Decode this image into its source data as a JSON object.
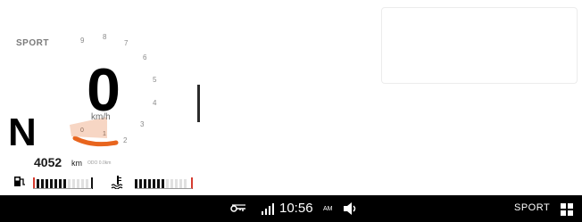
{
  "cluster": {
    "riding_mode": "SPORT",
    "speed": "0",
    "speed_unit": "km/h",
    "gear": "N",
    "odometer": "4052",
    "odometer_unit": "km",
    "odometer_sub": "ODO 0.0km",
    "rpm_ticks": [
      "9",
      "8",
      "7",
      "6",
      "5",
      "4",
      "3",
      "2",
      "1",
      "0"
    ],
    "fuel_level": 0.6,
    "temp_level": 0.55,
    "fuel_icon": "fuel-pump-icon",
    "temp_icon": "coolant-temp-icon",
    "accent_color": "#e8651e"
  },
  "status_bar": {
    "time": "10:56",
    "ampm": "AM",
    "mode": "SPORT",
    "icons": [
      "key-icon",
      "signal-strength-icon",
      "volume-icon",
      "grid-menu-icon"
    ]
  }
}
